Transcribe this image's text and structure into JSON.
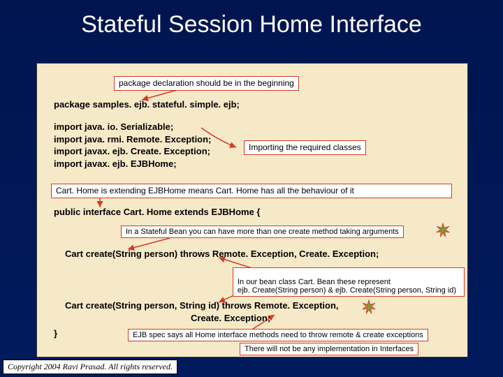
{
  "title": "Stateful Session Home Interface",
  "callouts": {
    "pkg_decl": "package declaration should be in the beginning",
    "import_classes": "Importing the required classes",
    "carthome_extends": "Cart. Home  is extending EJBHome means Cart. Home has all the behaviour of it",
    "stateful_create": "In a Stateful Bean you can have more than one create method  taking arguments",
    "bean_represent": "In our bean class Cart. Bean these represent\nejb. Create(String person) & ejb. Create(String person, String id)",
    "ejb_spec": "EJB spec says all Home interface methods need to throw remote & create exceptions",
    "no_impl": "There will not be any implementation in Interfaces"
  },
  "code": {
    "pkg_line": "package samples. ejb. stateful. simple. ejb;",
    "imports": "import java. io. Serializable;\nimport java. rmi. Remote. Exception;\nimport javax. ejb. Create. Exception;\nimport javax. ejb. EJBHome;",
    "public_interface": "public interface Cart. Home extends EJBHome {",
    "create1": "Cart create(String person) throws Remote. Exception, Create. Exception;",
    "create2_a": "Cart create(String person, String id) throws Remote. Exception,",
    "create2_b": "Create. Exception;",
    "close_brace": "}"
  },
  "copyright": "Copyright 2004 Ravi Prasad. All rights reserved.",
  "colors": {
    "callout_border": "#d43a25",
    "arrow": "#d43a25",
    "star_fill": "#7c9c3a",
    "star_stroke": "#d43a25"
  }
}
